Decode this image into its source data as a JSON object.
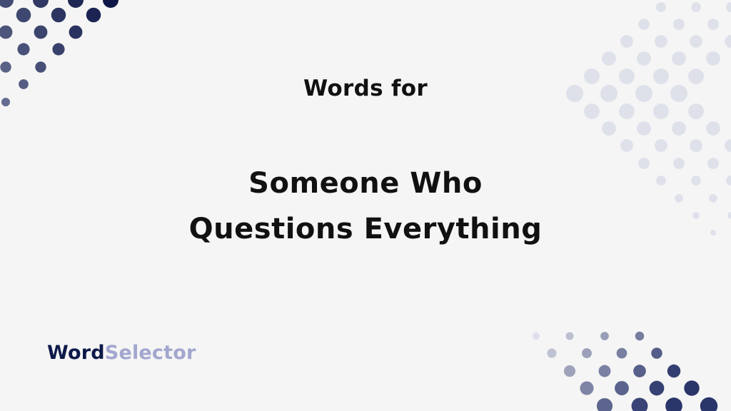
{
  "header": {
    "subtitle": "Words for",
    "title_line1": "Someone Who",
    "title_line2": "Questions Everything"
  },
  "brand": {
    "part1": "Word",
    "part2": "Selector",
    "color_primary": "#0e1a4a",
    "color_secondary": "#a3a7cf"
  },
  "decor": {
    "background": "#f5f5f5",
    "dot_color_dark": "#0e1a4a",
    "dot_color_light": "#dfe1ea"
  }
}
